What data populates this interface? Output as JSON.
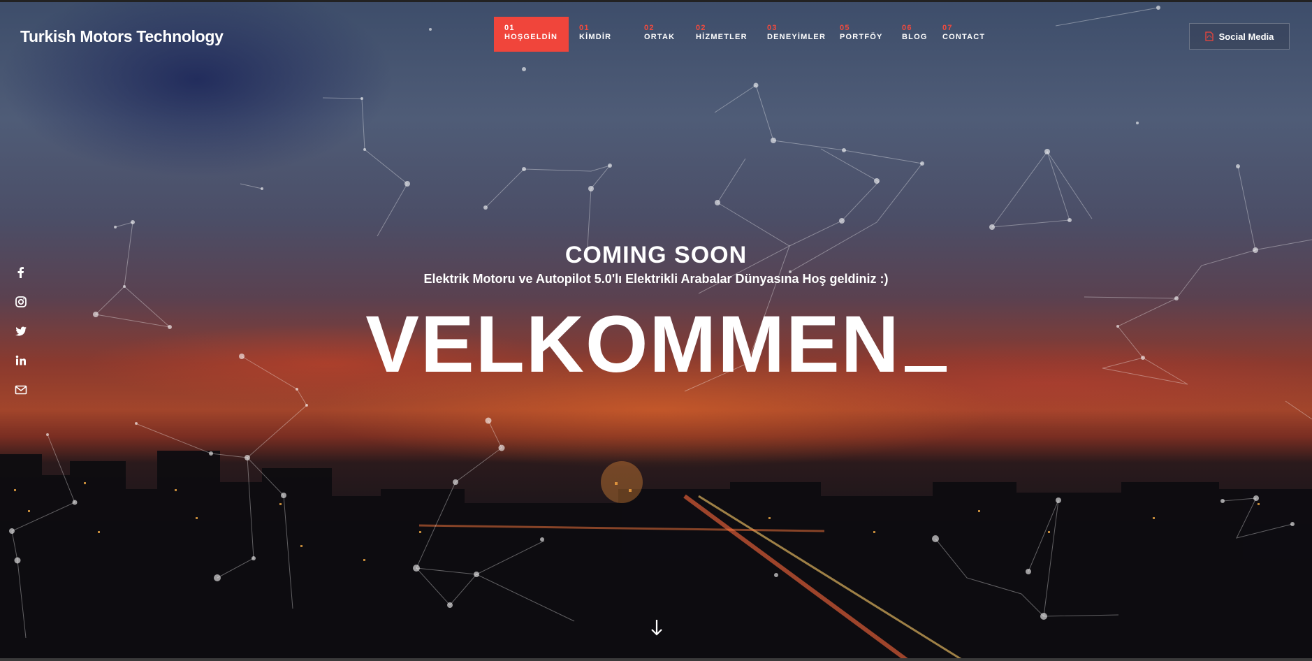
{
  "brand": "Turkish Motors Technology",
  "nav": [
    {
      "num": "01",
      "label": "HOŞGELDİN",
      "active": true
    },
    {
      "num": "01",
      "label": "KİMDİR"
    },
    {
      "num": "02",
      "label": "ORTAK"
    },
    {
      "num": "02",
      "label": "HİZMETLER"
    },
    {
      "num": "03",
      "label": "DENEYİMLER"
    },
    {
      "num": "05",
      "label": "PORTFÖY"
    },
    {
      "num": "06",
      "label": "BLOG"
    },
    {
      "num": "07",
      "label": "CONTACT"
    }
  ],
  "social_button": {
    "label": "Social Media",
    "icon": "file-icon"
  },
  "side_icons": [
    "facebook-icon",
    "instagram-icon",
    "twitter-icon",
    "linkedin-icon",
    "mail-icon"
  ],
  "hero": {
    "heading": "COMING SOON",
    "subtitle": "Elektrik Motoru ve Autopilot 5.0'lı Elektrikli Arabalar Dünyasına Hoş geldiniz :)",
    "headline": "VELKOMMEN"
  },
  "colors": {
    "accent": "#f0453b",
    "text": "#ffffff"
  }
}
